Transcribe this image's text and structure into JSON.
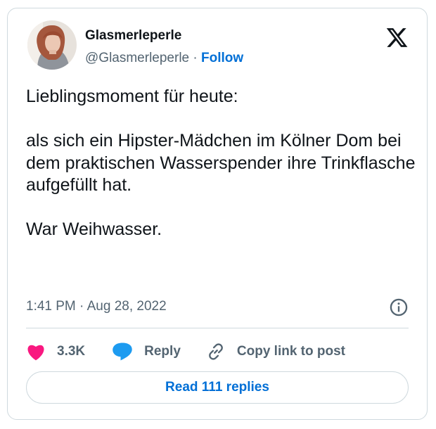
{
  "author": {
    "display_name": "Glasmerleperle",
    "handle": "@Glasmerleperle",
    "separator": "·",
    "follow_label": "Follow"
  },
  "tweet": {
    "text": "Lieblingsmoment für heute:\n\nals sich ein Hipster-Mädchen im Kölner Dom bei dem praktischen Wasserspender ihre Trinkflasche aufgefüllt hat.\n\nWar Weihwasser.",
    "time": "1:41 PM",
    "separator": "·",
    "date": "Aug 28, 2022"
  },
  "actions": {
    "like_count": "3.3K",
    "reply_label": "Reply",
    "copy_link_label": "Copy link to post"
  },
  "read_replies_label": "Read 111 replies",
  "icons": {
    "platform_logo": "x-logo-icon",
    "info": "info-icon",
    "like": "heart-icon",
    "reply": "speech-bubble-icon",
    "copy_link": "link-icon"
  },
  "colors": {
    "like": "#f91880",
    "reply": "#1d9bf0",
    "link_blue": "#006fd6",
    "secondary_text": "#536471",
    "border": "#cfd9de"
  }
}
